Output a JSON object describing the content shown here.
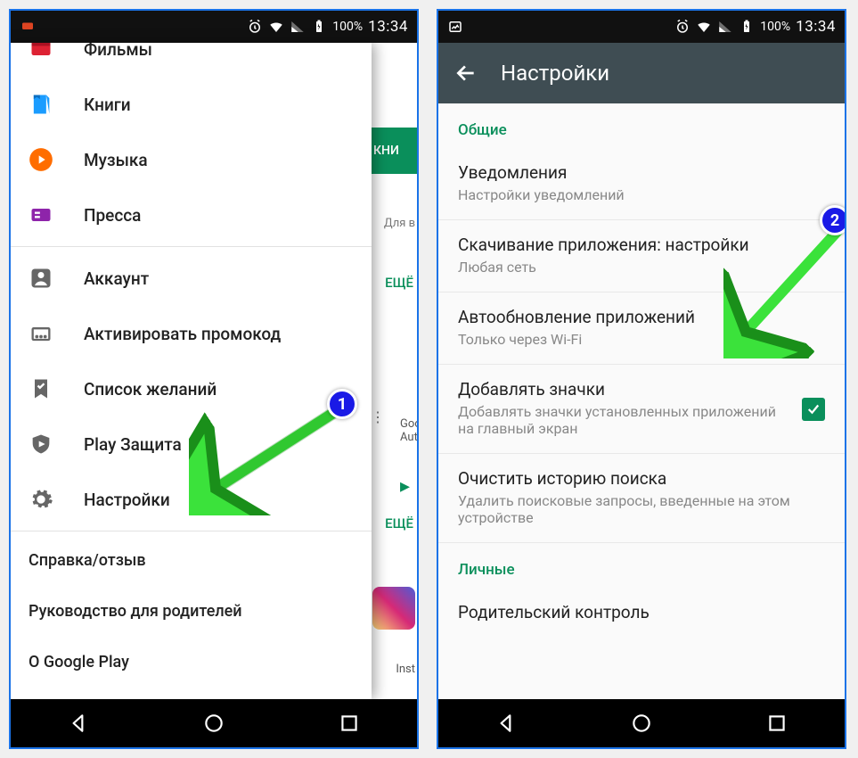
{
  "status": {
    "battery": "100%",
    "time": "13:34"
  },
  "leftPhone": {
    "backdrop": {
      "booksTab": "КНИ",
      "sub": "Для в",
      "more": "ЕЩЁ",
      "goo1": "Goo",
      "goo2": "Auth",
      "insta": "Inst"
    },
    "drawer": {
      "items": [
        {
          "label": "Фильмы"
        },
        {
          "label": "Книги"
        },
        {
          "label": "Музыка"
        },
        {
          "label": "Пресса"
        },
        {
          "label": "Аккаунт"
        },
        {
          "label": "Активировать промокод"
        },
        {
          "label": "Список желаний"
        },
        {
          "label": "Play Защита"
        },
        {
          "label": "Настройки"
        }
      ],
      "footer": [
        "Справка/отзыв",
        "Руководство для родителей",
        "О Google Play"
      ]
    }
  },
  "rightPhone": {
    "toolbarTitle": "Настройки",
    "sections": {
      "general": "Общие",
      "personal": "Личные"
    },
    "settings": [
      {
        "title": "Уведомления",
        "sub": "Настройки уведомлений"
      },
      {
        "title": "Скачивание приложения: настройки",
        "sub": "Любая сеть"
      },
      {
        "title": "Автообновление приложений",
        "sub": "Только через Wi-Fi"
      },
      {
        "title": "Добавлять значки",
        "sub": "Добавлять значки установленных приложений на главный экран"
      },
      {
        "title": "Очистить историю поиска",
        "sub": "Удалить поисковые запросы, введенные на этом устройстве"
      },
      {
        "title": "Родительский контроль",
        "sub": ""
      }
    ]
  },
  "annotations": {
    "badge1": "1",
    "badge2": "2"
  }
}
